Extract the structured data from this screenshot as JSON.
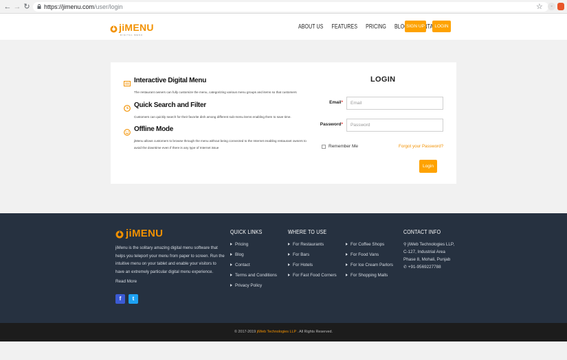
{
  "browser": {
    "back_icon": "arrow-left-icon",
    "forward_icon": "arrow-right-icon",
    "reload_icon": "reload-icon",
    "url_host": "https://jimenu.com",
    "url_path": "/user/login"
  },
  "header": {
    "logo_ji": "ji",
    "logo_menu": "MENU",
    "logo_tagline": "DIGITAL MENU",
    "nav": [
      "ABOUT US",
      "FEATURES",
      "PRICING",
      "BLOG",
      "CONTACT"
    ],
    "signup_label": "SIGN UP",
    "login_label": "LOGIN"
  },
  "features": [
    {
      "title": "Interactive Digital Menu",
      "desc": "The restaurant owners can fully customize the menu, categorizing various menu groups and items so that customers",
      "icon": "menu-card-icon"
    },
    {
      "title": "Quick Search and Filter",
      "desc": "Customers can quickly search for their favorite dish among different sub-menu items enabling them to save time.",
      "icon": "clock-icon"
    },
    {
      "title": "Offline Mode",
      "desc": "jiMenu allows customers to browse through the menu without being connected to the Internet enabling restaurant owners to avoid the downtime even if there is any type of Internet issue",
      "icon": "smiley-icon"
    }
  ],
  "login": {
    "title": "LOGIN",
    "email_label": "Email",
    "email_placeholder": "Email",
    "password_label": "Password",
    "password_placeholder": "Password",
    "required_mark": "*",
    "remember_label": "Remember Me",
    "forgot_label": "Forgot your Password?",
    "submit_label": "Login"
  },
  "footer": {
    "about": "jiMenu is the solitary amazing digital menu software that helps you teleport your menu from paper to screen. Run the intuitive menu on your tablet and enable your visitors to have an extremely particular digital menu experience.",
    "read_more": "Read More",
    "facebook": "f",
    "twitter": "t",
    "quick_links_title": "QUICK LINKS",
    "quick_links": [
      "Pricing",
      "Blog",
      "Contact",
      "Terms and Conditions",
      "Privacy Policy"
    ],
    "where_title": "WHERE TO USE",
    "where_col1": [
      "For Restaurants",
      "For Bars",
      "For Hotels",
      "For Fast Food Corners"
    ],
    "where_col2": [
      "For Coffee Shops",
      "For Food Vans",
      "For Ice Cream Parlors",
      "For Shopping Malls"
    ],
    "contact_title": "CONTACT INFO",
    "contact_lines": [
      "jiWeb Technologies LLP,",
      "C-127, Industrial Area",
      "Phase 8, Mohali, Punjab",
      "+91-9569227788"
    ],
    "copyright_pre": "© 2017-2019 ",
    "copyright_company": "jiWeb Technologies LLP",
    "copyright_post": " . All Rights Reserved."
  },
  "colors": {
    "accent": "#fea200",
    "footer_bg": "#263140",
    "copyright_bg": "#1c1c1c"
  }
}
